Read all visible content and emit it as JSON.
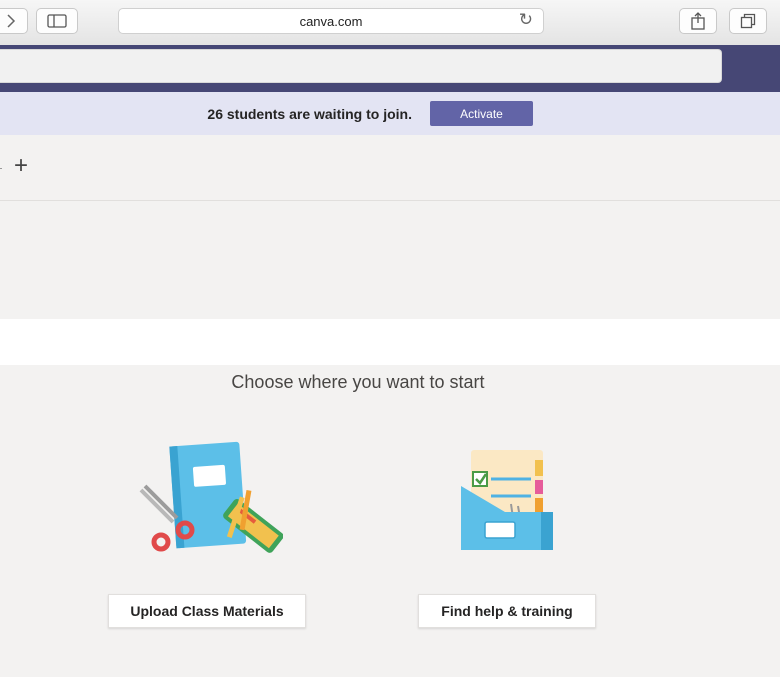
{
  "browser": {
    "url": "canva.com",
    "icons": [
      "forward-icon",
      "sidebar-icon",
      "reload-icon",
      "share-icon",
      "tabs-icon"
    ]
  },
  "banner": {
    "message": "26 students are waiting to join.",
    "action_label": "Activate"
  },
  "tabs": {
    "add_symbol": "+"
  },
  "main": {
    "heading": "Choose where you want to start",
    "cards": [
      {
        "label": "Upload Class Materials",
        "icon": "notebook-scissors-illustration"
      },
      {
        "label": "Find help & training",
        "icon": "folder-documents-illustration"
      }
    ]
  },
  "colors": {
    "header": "#464775",
    "accent": "#6264a7",
    "notice_bg": "#e3e4f3"
  }
}
